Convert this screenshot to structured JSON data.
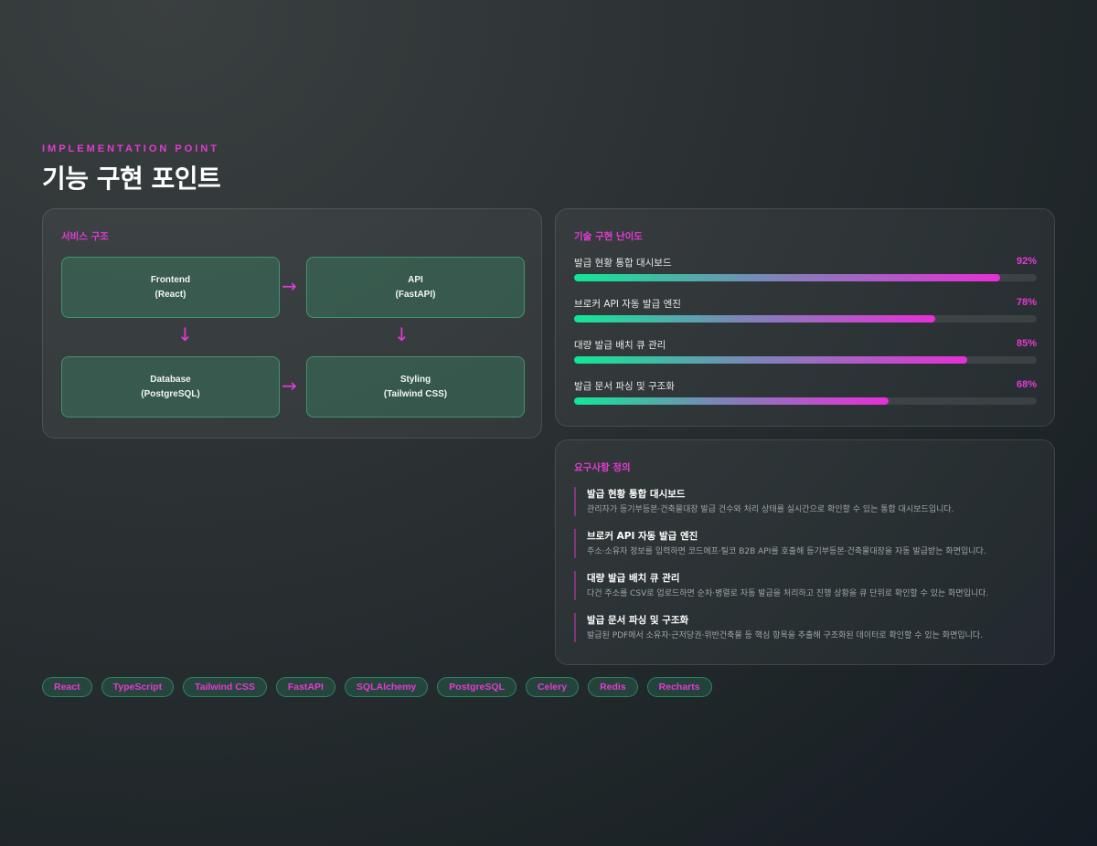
{
  "header": {
    "eyebrow": "IMPLEMENTATION POINT",
    "title": "기능 구현 포인트"
  },
  "architecture": {
    "title": "서비스 구조",
    "nodes": [
      {
        "name": "Frontend",
        "tech": "(React)"
      },
      {
        "name": "API",
        "tech": "(FastAPI)"
      },
      {
        "name": "Database",
        "tech": "(PostgreSQL)"
      },
      {
        "name": "Styling",
        "tech": "(Tailwind CSS)"
      }
    ],
    "arrows": {
      "right": "→",
      "down": "↓"
    }
  },
  "difficulty": {
    "title": "기술 구현 난이도",
    "items": [
      {
        "label": "발급 현황 통합 대시보드",
        "percent_text": "92%",
        "value": 92
      },
      {
        "label": "브로커 API 자동 발급 엔진",
        "percent_text": "78%",
        "value": 78
      },
      {
        "label": "대량 발급 배치 큐 관리",
        "percent_text": "85%",
        "value": 85
      },
      {
        "label": "발급 문서 파싱 및 구조화",
        "percent_text": "68%",
        "value": 68
      }
    ]
  },
  "requirements": {
    "title": "요구사항 정의",
    "items": [
      {
        "title": "발급 현황 통합 대시보드",
        "desc": "관리자가 등기부등본·건축물대장 발급 건수와 처리 상태를 실시간으로 확인할 수 있는 통합 대시보드입니다."
      },
      {
        "title": "브로커 API 자동 발급 엔진",
        "desc": "주소·소유자 정보를 입력하면 코드에프·틸코 B2B API를 호출해 등기부등본·건축물대장을 자동 발급받는 화면입니다."
      },
      {
        "title": "대량 발급 배치 큐 관리",
        "desc": "다건 주소를 CSV로 업로드하면 순차·병렬로 자동 발급을 처리하고 진행 상황을 큐 단위로 확인할 수 있는 화면입니다."
      },
      {
        "title": "발급 문서 파싱 및 구조화",
        "desc": "발급된 PDF에서 소유자·근저당권·위반건축물 등 핵심 항목을 추출해 구조화된 데이터로 확인할 수 있는 화면입니다."
      }
    ]
  },
  "tags": [
    "React",
    "TypeScript",
    "Tailwind CSS",
    "FastAPI",
    "SQLAlchemy",
    "PostgreSQL",
    "Celery",
    "Redis",
    "Recharts"
  ],
  "colors": {
    "accent": "#e53ad3",
    "bar_start": "#10e896",
    "bar_end": "#e72fd7",
    "node_border": "#46c88c"
  }
}
